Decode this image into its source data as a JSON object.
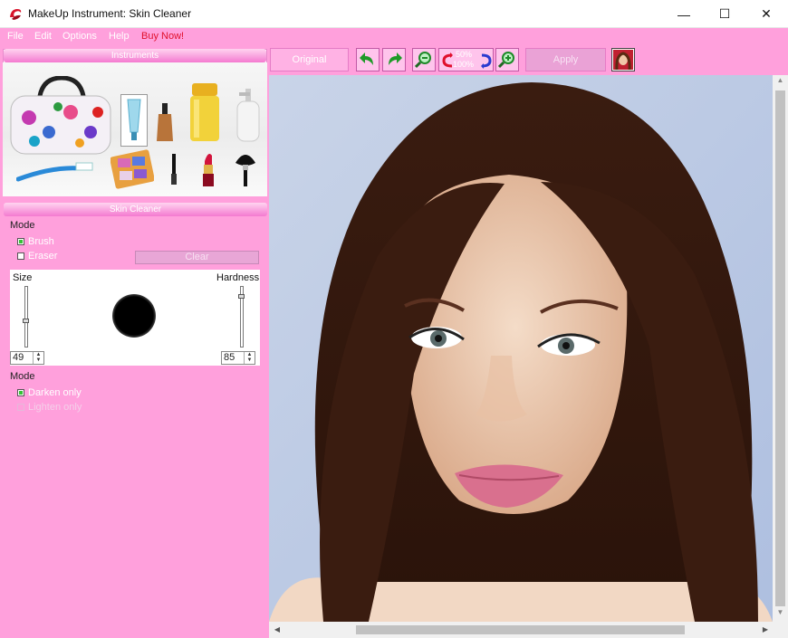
{
  "window": {
    "title": "MakeUp Instrument: Skin Cleaner",
    "minimize": "—",
    "maximize": "☐",
    "close": "✕"
  },
  "menu": {
    "file": "File",
    "edit": "Edit",
    "options": "Options",
    "help": "Help",
    "buy": "Buy Now!"
  },
  "instruments": {
    "header": "Instruments"
  },
  "skin_cleaner": {
    "header": "Skin Cleaner",
    "mode1_label": "Mode",
    "brush": "Brush",
    "eraser": "Eraser",
    "clear": "Clear",
    "size_label": "Size",
    "hardness_label": "Hardness",
    "size_value": "49",
    "hardness_value": "85",
    "mode2_label": "Mode",
    "darken_only": "Darken only",
    "lighten_only": "Lighten only"
  },
  "toolbar": {
    "original": "Original",
    "zoom_50": "50%",
    "zoom_100": "100%",
    "apply": "Apply"
  },
  "scroll": {
    "up": "▲",
    "down": "▼",
    "left": "◀",
    "right": "▶"
  },
  "colors": {
    "pink": "#ffa0dc",
    "buy": "#e0102c",
    "radio_on": "#35c135"
  }
}
